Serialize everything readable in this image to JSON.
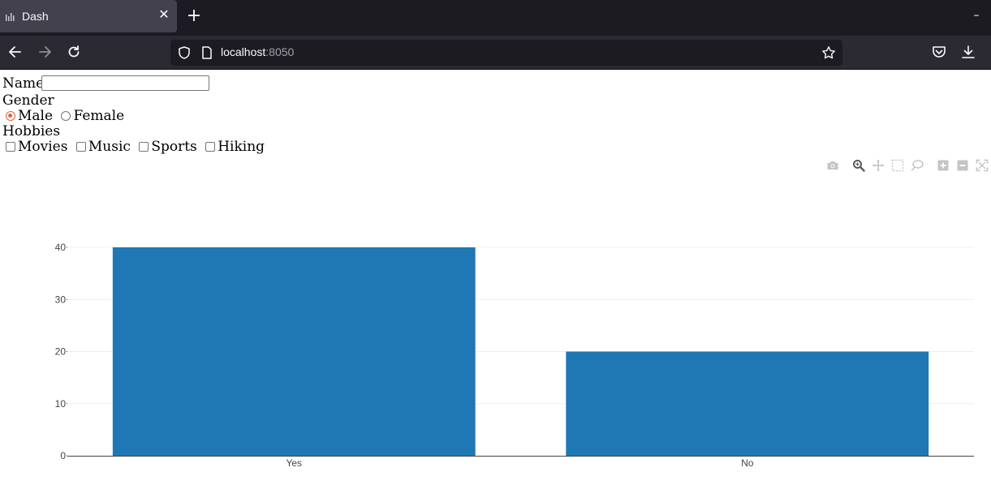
{
  "browser": {
    "tab_title": "Dash",
    "url_host": "localhost",
    "url_port": ":8050"
  },
  "form": {
    "name_label": "Name",
    "name_value": "",
    "gender_label": "Gender",
    "gender_options": [
      "Male",
      "Female"
    ],
    "gender_selected": "Male",
    "hobbies_label": "Hobbies",
    "hobbies_options": [
      "Movies",
      "Music",
      "Sports",
      "Hiking"
    ]
  },
  "modebar": [
    "camera-icon",
    "zoom-icon",
    "pan-icon",
    "box-select-icon",
    "lasso-icon",
    "zoom-in-icon",
    "zoom-out-icon",
    "autoscale-icon"
  ],
  "chart_data": {
    "type": "bar",
    "categories": [
      "Yes",
      "No"
    ],
    "values": [
      40,
      20
    ],
    "ylim": [
      0,
      40
    ],
    "yticks": [
      0,
      10,
      20,
      30,
      40
    ],
    "grid": true,
    "bar_color": "#1f77b4"
  }
}
